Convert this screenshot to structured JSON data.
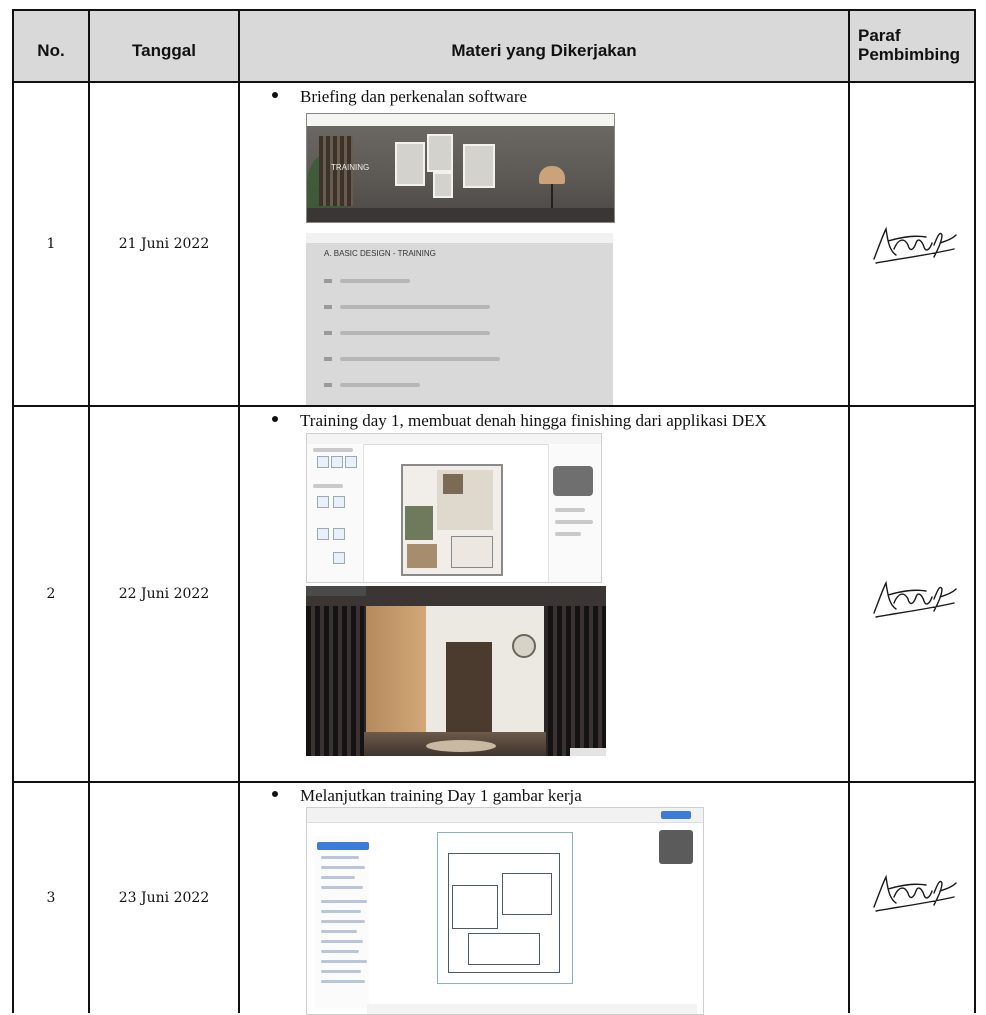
{
  "table": {
    "headers": {
      "no": "No.",
      "tanggal": "Tanggal",
      "materi": "Materi yang Dikerjakan",
      "paraf_line1": "Paraf",
      "paraf_line2": "Pembimbing"
    },
    "rows": [
      {
        "no": "1",
        "tanggal": "21 Juni 2022",
        "materi": "Briefing dan perkenalan software",
        "image_a_caption": "TRAINING",
        "image_b_title": "A. BASIC DESIGN - TRAINING"
      },
      {
        "no": "2",
        "tanggal": "22 Juni 2022",
        "materi": "Training day 1, membuat denah hingga finishing dari applikasi DEX"
      },
      {
        "no": "3",
        "tanggal": "23 Juni 2022",
        "materi": "Melanjutkan training Day 1 gambar kerja"
      }
    ]
  },
  "colors": {
    "header_bg": "#d9d9d9",
    "border": "#111111",
    "signature_ink": "#1a1a1a"
  },
  "icons": {
    "bullet": "bullet-dot",
    "signature": "signature-mark"
  }
}
